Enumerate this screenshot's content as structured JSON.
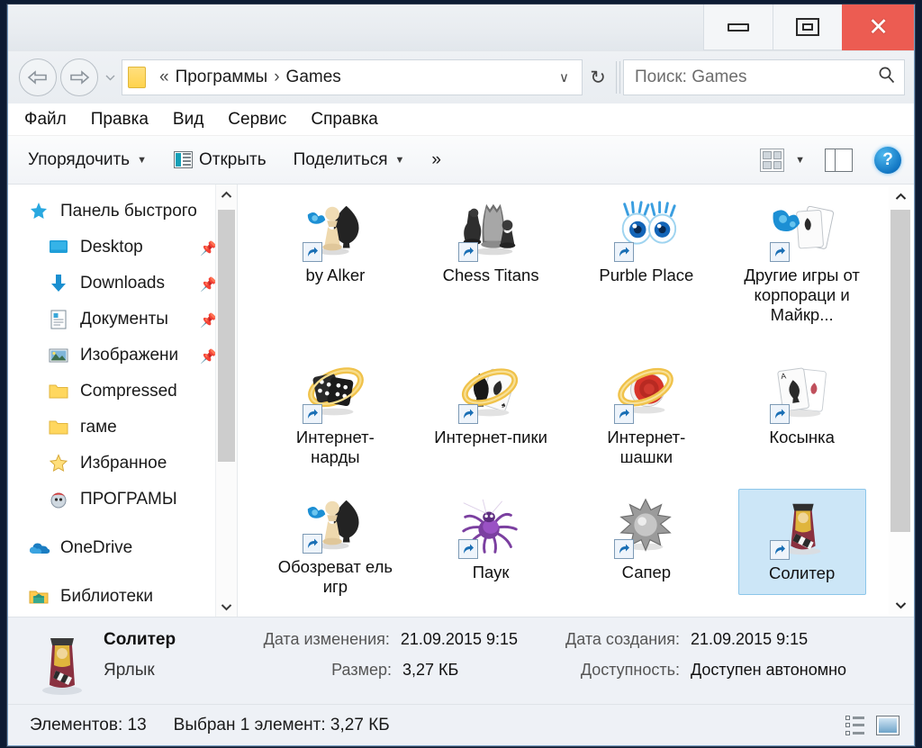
{
  "window": {
    "controls": {
      "minimize_label": "−",
      "maximize_label": "□",
      "close_label": "✕"
    },
    "close_color": "#ec5c52"
  },
  "address": {
    "back_icon": "back-arrow-icon",
    "forward_icon": "forward-arrow-icon",
    "dropdown_icon": "chevron-down-icon",
    "folder_icon": "folder-icon",
    "prefix": "«",
    "crumbs": [
      "Программы",
      "Games"
    ],
    "separator": "›",
    "refresh_icon": "↻",
    "chevron": "∨"
  },
  "search": {
    "placeholder": "Поиск: Games",
    "icon": "search-icon"
  },
  "menubar": {
    "items": [
      "Файл",
      "Правка",
      "Вид",
      "Сервис",
      "Справка"
    ]
  },
  "toolbar": {
    "organize_label": "Упорядочить",
    "open_label": "Открыть",
    "share_label": "Поделиться",
    "overflow_label": "»",
    "caret": "▼",
    "view_icon": "view-layout-icon",
    "preview_pane_icon": "preview-pane-icon",
    "help_label": "?"
  },
  "sidebar": {
    "items": [
      {
        "label": "Панель быстрого",
        "icon": "quick-access-star-icon",
        "pinned": false,
        "root": true
      },
      {
        "label": "Desktop",
        "icon": "desktop-icon",
        "pinned": true,
        "root": false
      },
      {
        "label": "Downloads",
        "icon": "downloads-arrow-icon",
        "pinned": true,
        "root": false
      },
      {
        "label": "Документы",
        "icon": "documents-icon",
        "pinned": true,
        "root": false
      },
      {
        "label": "Изображени",
        "icon": "pictures-icon",
        "pinned": true,
        "root": false
      },
      {
        "label": "Compressed",
        "icon": "folder-icon",
        "pinned": false,
        "root": false
      },
      {
        "label": "гаме",
        "icon": "folder-icon",
        "pinned": false,
        "root": false
      },
      {
        "label": "Избранное",
        "icon": "favorites-star-icon",
        "pinned": false,
        "root": false
      },
      {
        "label": "ПРОГРАМЫ",
        "icon": "programs-icon",
        "pinned": false,
        "root": false
      },
      {
        "label": "OneDrive",
        "icon": "onedrive-cloud-icon",
        "pinned": false,
        "root": true
      },
      {
        "label": "Библиотеки",
        "icon": "libraries-icon",
        "pinned": false,
        "root": true
      }
    ],
    "scroll_up_icon": "chevron-up-icon",
    "scroll_down_icon": "chevron-down-icon"
  },
  "files": {
    "items": [
      {
        "label": "by Alker",
        "icon": "chess-pawn-spade-icon",
        "selected": false,
        "row": "r1"
      },
      {
        "label": "Chess Titans",
        "icon": "chess-pieces-icon",
        "selected": false,
        "row": "r1"
      },
      {
        "label": "Purble Place",
        "icon": "cartoon-eyes-icon",
        "selected": false,
        "row": "r1"
      },
      {
        "label": "Другие игры от корпораци и Майкр...",
        "icon": "puzzle-cards-icon",
        "selected": false,
        "row": "r1"
      },
      {
        "label": "Интернет-нарды",
        "icon": "dice-ring-icon",
        "selected": false,
        "row": "r2"
      },
      {
        "label": "Интернет-пики",
        "icon": "spade-card-ring-icon",
        "selected": false,
        "row": "r2"
      },
      {
        "label": "Интернет-шашки",
        "icon": "checkers-ring-icon",
        "selected": false,
        "row": "r2"
      },
      {
        "label": "Косынка",
        "icon": "ace-spades-card-icon",
        "selected": false,
        "row": "r2"
      },
      {
        "label": "Обозреват ель игр",
        "icon": "chess-pawn-spade-icon",
        "selected": false,
        "row": "r3"
      },
      {
        "label": "Паук",
        "icon": "spider-icon",
        "selected": false,
        "row": "r3"
      },
      {
        "label": "Сапер",
        "icon": "mine-icon",
        "selected": false,
        "row": "r3"
      },
      {
        "label": "Солитер",
        "icon": "king-card-icon",
        "selected": true,
        "row": "r3"
      }
    ],
    "shortcut_badge_icon": "shortcut-arrow-icon",
    "scroll_up_icon": "chevron-up-icon",
    "scroll_down_icon": "chevron-down-icon"
  },
  "details": {
    "thumb_icon": "king-card-icon",
    "name": "Солитер",
    "type": "Ярлык",
    "fields_left": [
      {
        "key": "Дата изменения:",
        "value": "21.09.2015 9:15"
      },
      {
        "key": "Размер:",
        "value": "3,27 КБ"
      }
    ],
    "fields_right": [
      {
        "key": "Дата создания:",
        "value": "21.09.2015 9:15"
      },
      {
        "key": "Доступность:",
        "value": "Доступен автономно"
      }
    ]
  },
  "status": {
    "count_text": "Элементов: 13",
    "selection_text": "Выбран 1 элемент: 3,27 КБ",
    "details_view_icon": "details-view-icon",
    "large_icons_view_icon": "large-icons-view-icon"
  }
}
